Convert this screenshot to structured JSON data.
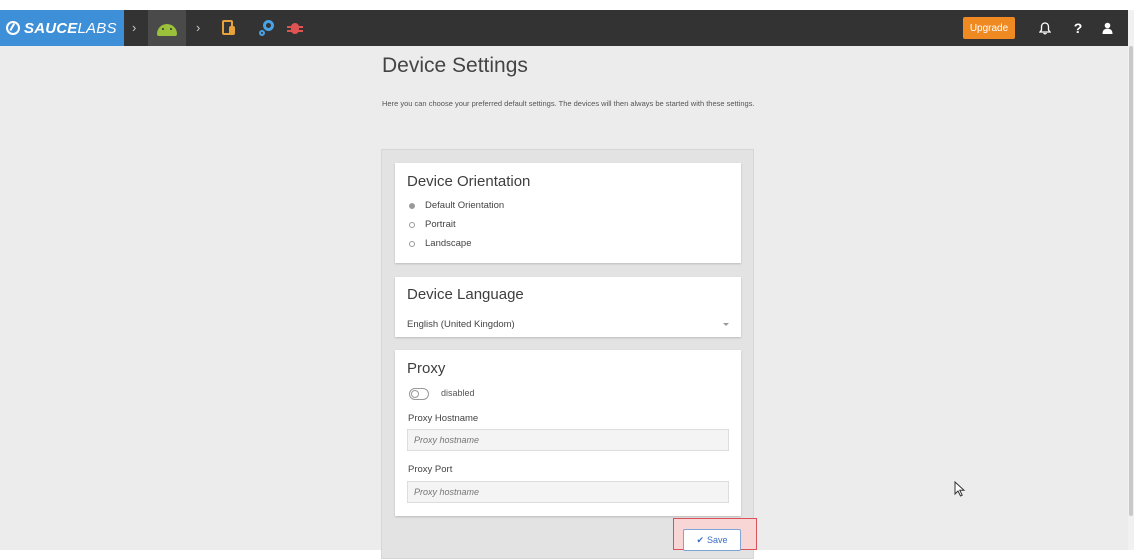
{
  "navbar": {
    "logo_bold": "SAUCE",
    "logo_light": "LABS",
    "sep1": "›",
    "sep2": "›",
    "upgrade_label": "Upgrade",
    "help_label": "?",
    "icons": [
      "sauce-logo-icon",
      "android-icon",
      "phone-touch-icon",
      "gear-icon",
      "bug-icon",
      "bell-icon",
      "help-icon",
      "user-icon"
    ]
  },
  "page": {
    "title": "Device Settings",
    "description": "Here you can choose your preferred default settings. The devices will then always be started with these settings."
  },
  "orientation": {
    "title": "Device Orientation",
    "options": [
      {
        "label": "Default Orientation",
        "checked": true
      },
      {
        "label": "Portrait",
        "checked": false
      },
      {
        "label": "Landscape",
        "checked": false
      }
    ]
  },
  "language": {
    "title": "Device Language",
    "selected": "English (United Kingdom)"
  },
  "proxy": {
    "title": "Proxy",
    "toggle_state": "disabled",
    "hostname_label": "Proxy Hostname",
    "hostname_placeholder": "Proxy hostname",
    "port_label": "Proxy Port",
    "port_placeholder": "Proxy hostname"
  },
  "actions": {
    "save_label": "Save"
  },
  "colors": {
    "navbar": "#333334",
    "logo_bg": "#3d8fd8",
    "upgrade": "#ef8a23",
    "save_text": "#3a6fc2",
    "highlight_border": "#d8535d"
  }
}
